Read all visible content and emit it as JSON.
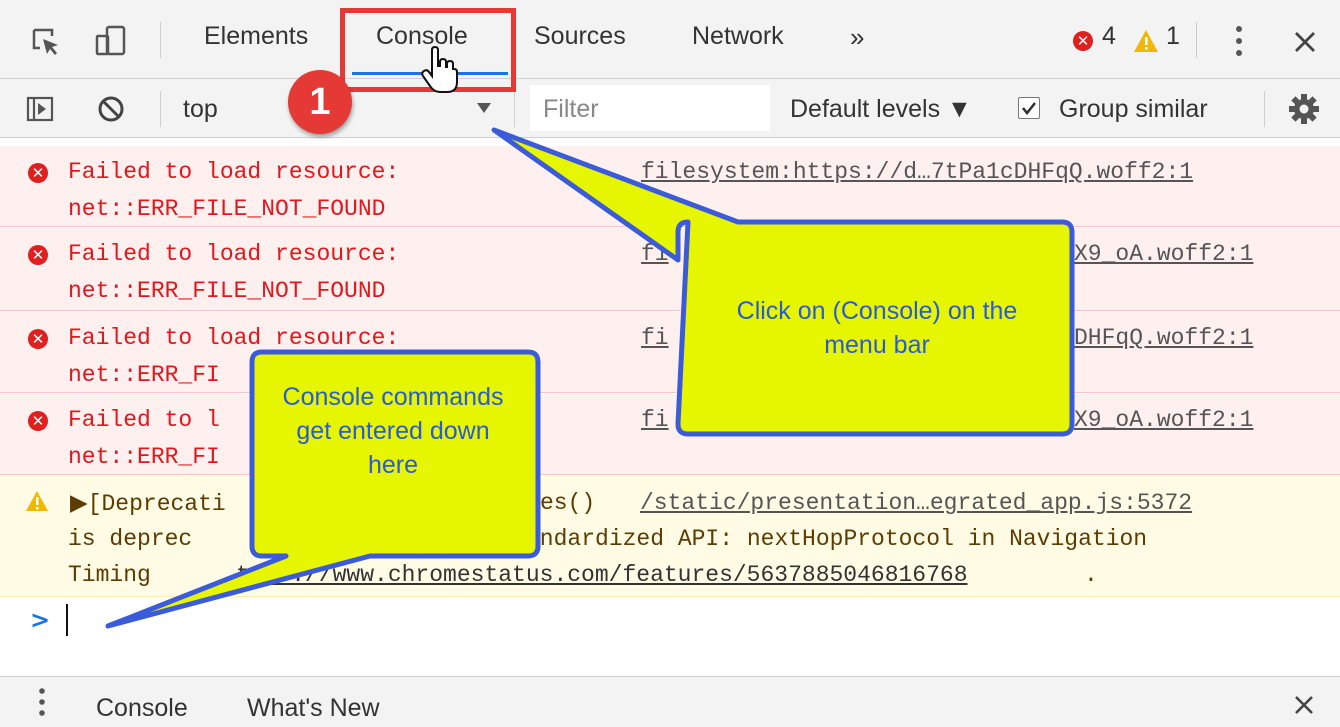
{
  "tabs": {
    "elements": "Elements",
    "console": "Console",
    "sources": "Sources",
    "network": "Network",
    "more": "»"
  },
  "counts": {
    "errors": "4",
    "warnings": "1"
  },
  "toolbar": {
    "context": "top",
    "filter_placeholder": "Filter",
    "levels": "Default levels ▼",
    "group_similar": "Group similar"
  },
  "messages": [
    {
      "line1": "Failed to load resource:",
      "line2": "net::ERR_FILE_NOT_FOUND",
      "source": "filesystem:https://d…7tPa1cDHFqQ.woff2:1"
    },
    {
      "line1": "Failed to load resource:",
      "line2": "net::ERR_FILE_NOT_FOUND",
      "source": "fi",
      "source_tail": "X9_oA.woff2:1"
    },
    {
      "line1": "Failed to load resource:",
      "line2": "net::ERR_FI",
      "source": "fi",
      "source_tail": "DHFqQ.woff2:1"
    },
    {
      "line1": "Failed to l",
      "line2": "net::ERR_FI",
      "source": "fi",
      "source_tail": "X9_oA.woff2:1"
    }
  ],
  "warning": {
    "prefix": "▶[Deprecati",
    "mid": "es()",
    "source": "/static/presentation…egrated_app.js:5372",
    "line2a": "is deprec",
    "line2b": "andardized API: nextHopProtocol in Navigation",
    "line3a": "Timing",
    "line3b": "ttps://www.chromestatus.com/features/5637885046816768",
    "line3c": "."
  },
  "prompt": ">",
  "drawer": {
    "console": "Console",
    "whats_new": "What's New"
  },
  "callouts": {
    "step_number": "1",
    "console_tab_note": "Click on (Console) on the menu bar",
    "input_note": "Console commands get entered down here"
  },
  "colors": {
    "error": "#e2171b",
    "warning_icon": "#f2b705",
    "callout_fill": "#e6f500",
    "callout_border": "#3b5bdb",
    "highlight_box": "#e53935"
  }
}
